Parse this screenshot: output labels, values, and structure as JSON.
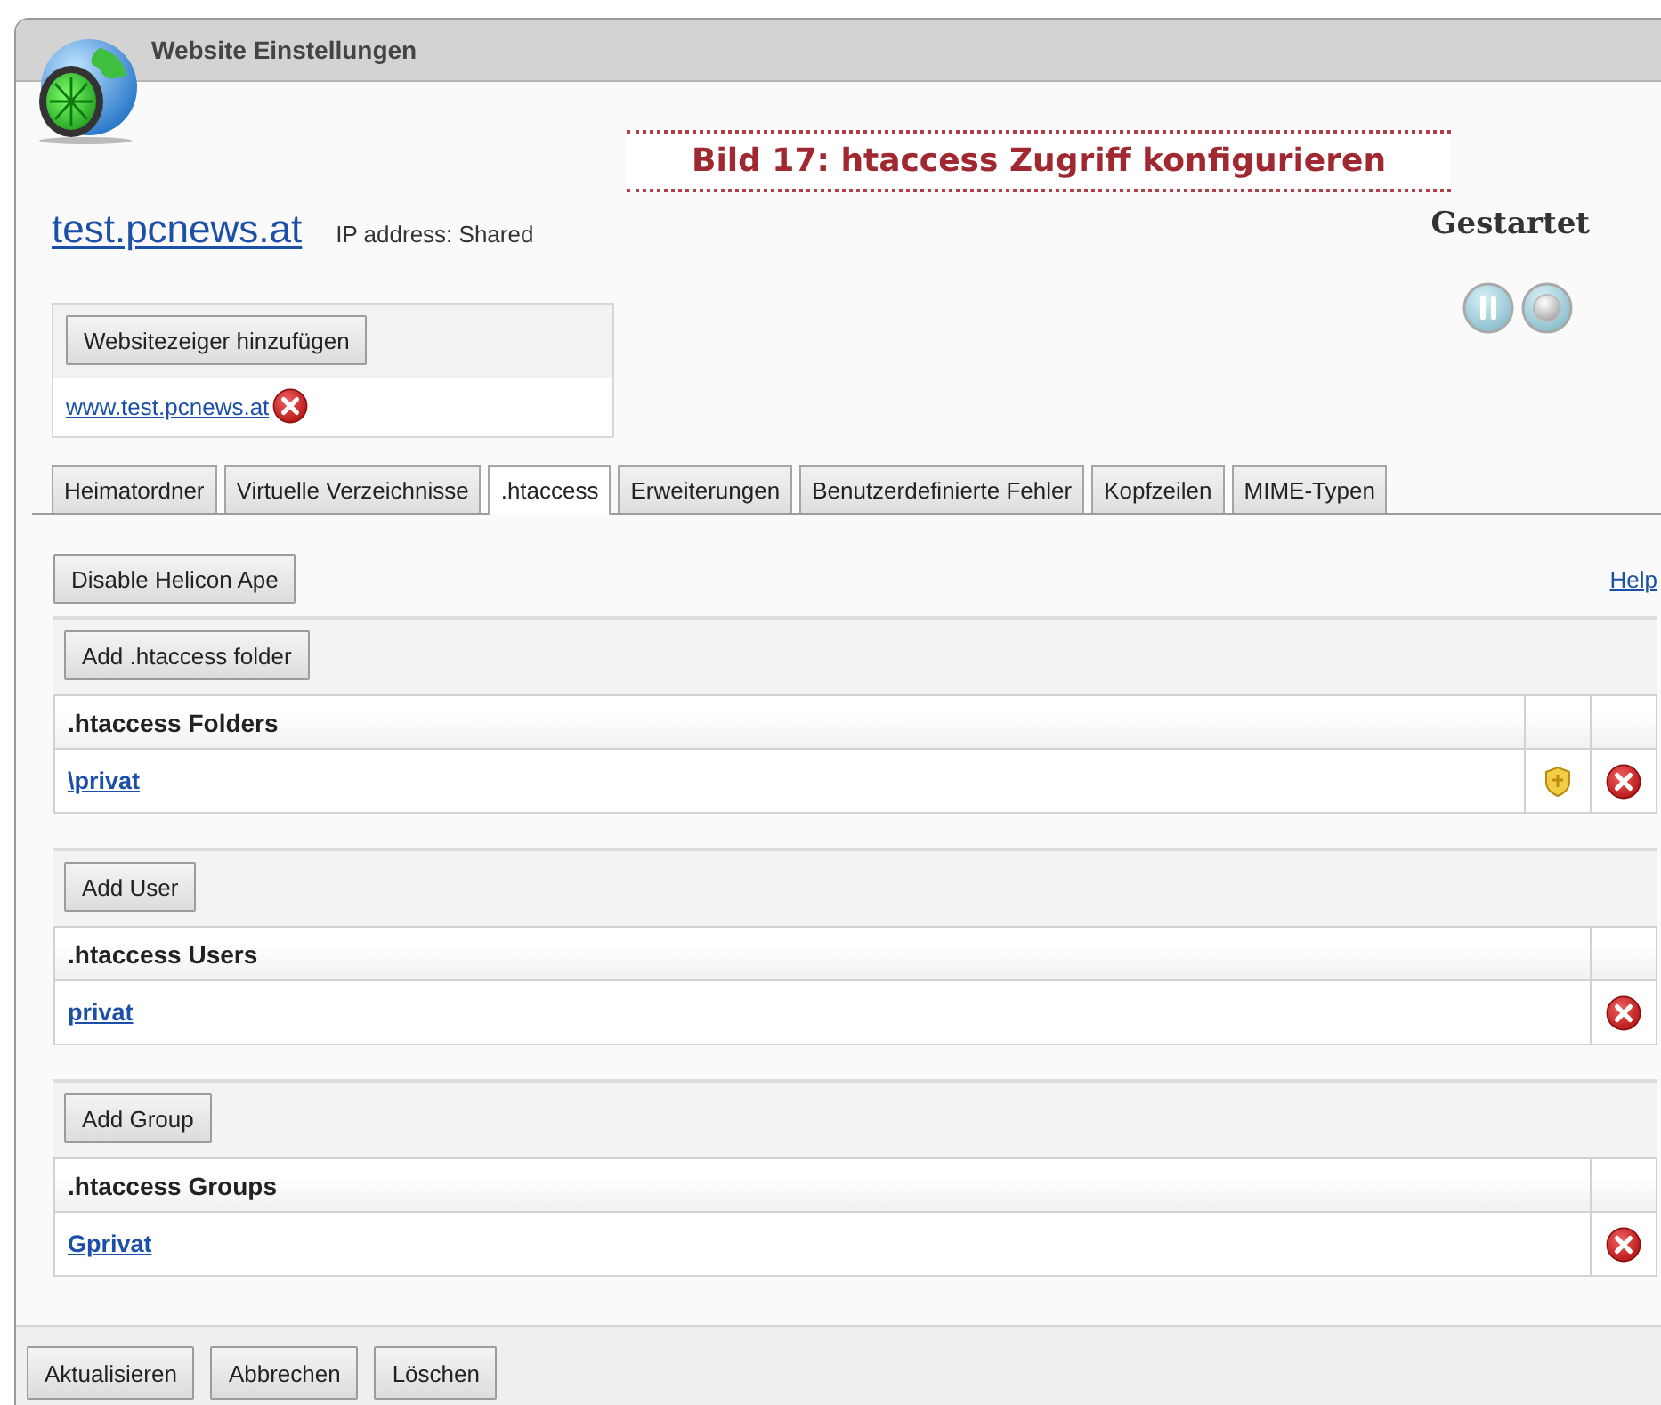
{
  "window": {
    "title": "Website Einstellungen"
  },
  "caption": "Bild 17: htaccess Zugriff konfigurieren",
  "site": {
    "name": "test.pcnews.at",
    "ip": "IP address: Shared"
  },
  "status": {
    "label": "Gestartet"
  },
  "pointers": {
    "button": "Websitezeiger hinzufügen",
    "links": [
      "www.test.pcnews.at"
    ]
  },
  "tabs": [
    {
      "label": "Heimatordner",
      "selected": false
    },
    {
      "label": "Virtuelle Verzeichnisse",
      "selected": false
    },
    {
      "label": ".htaccess",
      "selected": true
    },
    {
      "label": "Erweiterungen",
      "selected": false
    },
    {
      "label": "Benutzerdefinierte Fehler",
      "selected": false
    },
    {
      "label": "Kopfzeilen",
      "selected": false
    },
    {
      "label": "MIME-Typen",
      "selected": false
    }
  ],
  "toolbar": {
    "button": "Disable Helicon Ape",
    "help": "Help"
  },
  "sections": [
    {
      "kind": "folders",
      "button": "Add .htaccess folder",
      "heading": ".htaccess Folders",
      "rows": [
        "\\privat"
      ]
    },
    {
      "kind": "users",
      "button": "Add User",
      "heading": ".htaccess Users",
      "rows": [
        "privat"
      ]
    },
    {
      "kind": "groups",
      "button": "Add Group",
      "heading": ".htaccess Groups",
      "rows": [
        "Gprivat"
      ]
    }
  ],
  "footer": [
    "Aktualisieren",
    "Abbrechen",
    "Löschen"
  ]
}
